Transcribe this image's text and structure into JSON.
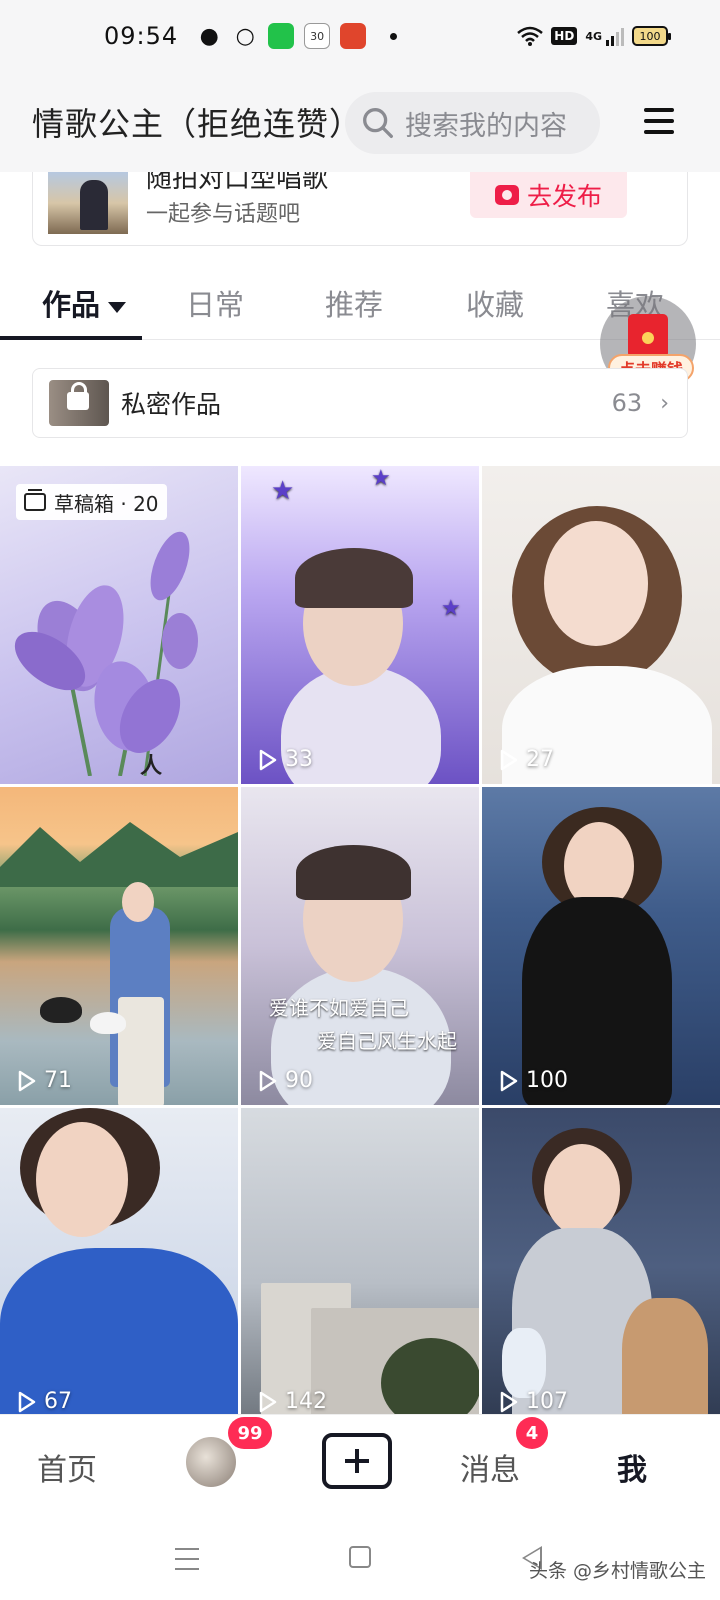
{
  "status_bar": {
    "time": "09:54",
    "network": "4G",
    "hd": "HD",
    "battery": "100",
    "calendar_day": "30",
    "icons": [
      "wechat-icon",
      "chat-bubble-icon",
      "green-app-icon",
      "calendar-icon",
      "game-app-icon",
      "wifi-icon",
      "hd-icon",
      "signal-icon",
      "battery-icon"
    ]
  },
  "header": {
    "profile_name": "情歌公主（拒绝连赞）",
    "search_placeholder": "搜索我的内容",
    "menu_icon": "hamburger-icon"
  },
  "challenge": {
    "title": "随拍对口型唱歌",
    "subtitle": "一起参与话题吧",
    "publish_label": "去发布"
  },
  "tabs": [
    {
      "label": "作品",
      "active": true
    },
    {
      "label": "日常",
      "active": false
    },
    {
      "label": "推荐",
      "active": false
    },
    {
      "label": "收藏",
      "active": false
    },
    {
      "label": "喜欢",
      "active": false
    }
  ],
  "floating_reward": {
    "label": "点击赚钱"
  },
  "private_works": {
    "label": "私密作品",
    "count": "63"
  },
  "grid": {
    "draft_label": "草稿箱 · 20",
    "tiles": [
      {
        "plays": "",
        "theme": "lotus"
      },
      {
        "plays": "33",
        "theme": "purple-stars"
      },
      {
        "plays": "27",
        "theme": "white-shirt"
      },
      {
        "plays": "71",
        "theme": "lake-swans"
      },
      {
        "plays": "90",
        "theme": "karaoke",
        "caption_1": "爱谁不如爱自己",
        "caption_2": "爱自己风生水起"
      },
      {
        "plays": "100",
        "theme": "black-scarf"
      },
      {
        "plays": "67",
        "theme": "blue-shirt"
      },
      {
        "plays": "142",
        "theme": "sky-building"
      },
      {
        "plays": "107",
        "theme": "robot-dog"
      }
    ],
    "tile1_text": "人"
  },
  "bottom_nav": {
    "home": "首页",
    "friends_badge": "99",
    "messages": "消息",
    "messages_badge": "4",
    "me": "我"
  },
  "watermark": "头条 @乡村情歌公主",
  "colors": {
    "accent": "#fe2c55",
    "publish_text": "#ee1e48",
    "header_bg": "#f6f6f7"
  }
}
